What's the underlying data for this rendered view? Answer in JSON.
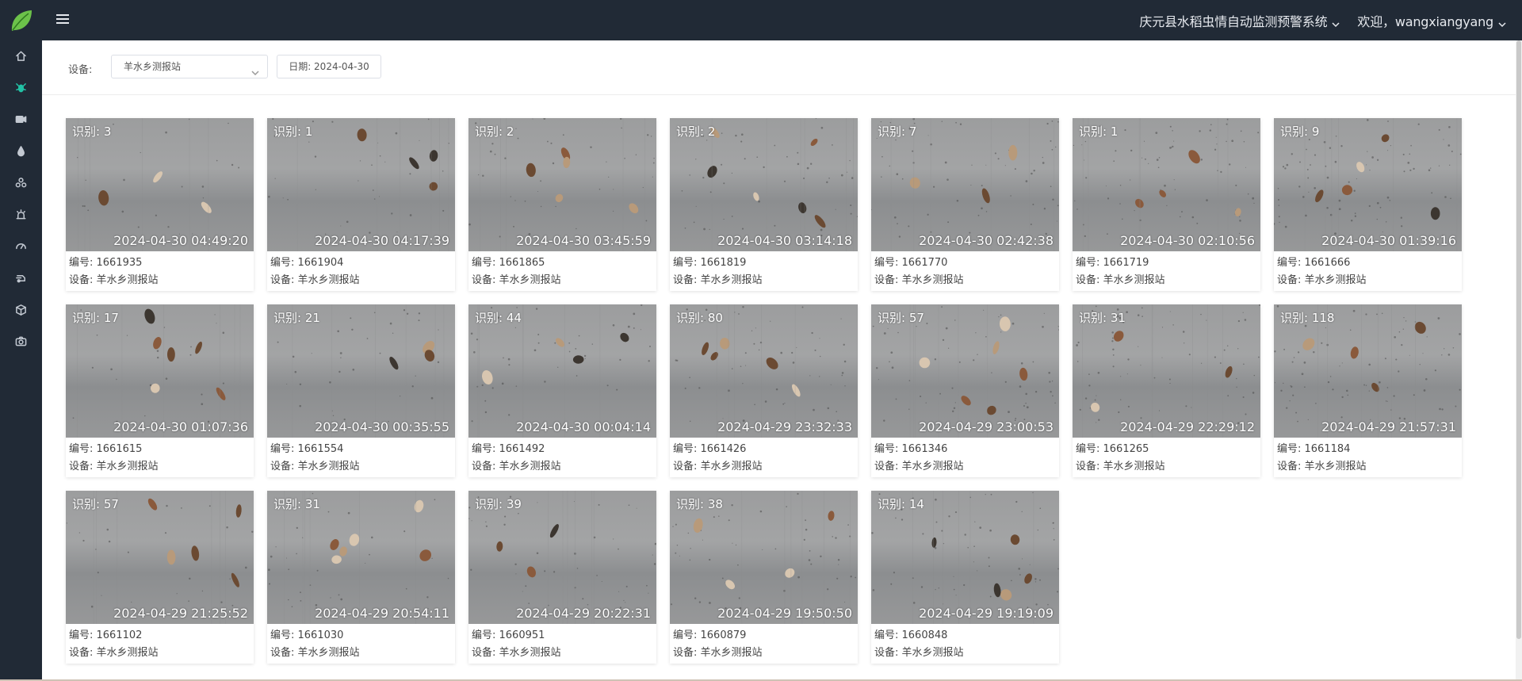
{
  "app": {
    "logo_icon": "leaf-logo-icon",
    "menu_icon": "hamburger-icon",
    "system_name": "庆元县水稻虫情自动监测预警系统",
    "welcome": "欢迎，wangxiangyang",
    "accent_color": "#22c1a5",
    "nav_background": "#212a36"
  },
  "sidebar": {
    "items": [
      {
        "icon": "home-icon",
        "active": false
      },
      {
        "icon": "bug-icon",
        "active": true
      },
      {
        "icon": "video-camera-icon",
        "active": false
      },
      {
        "icon": "water-drop-icon",
        "active": false
      },
      {
        "icon": "cluster-icon",
        "active": false
      },
      {
        "icon": "alarm-light-icon",
        "active": false
      },
      {
        "icon": "speedometer-icon",
        "active": false
      },
      {
        "icon": "trap-device-icon",
        "active": false
      },
      {
        "icon": "box-icon",
        "active": false
      },
      {
        "icon": "camera-icon",
        "active": false
      }
    ]
  },
  "filters": {
    "device_label": "设备:",
    "device_value": "羊水乡测报站",
    "date_value": "日期: 2024-04-30"
  },
  "records": [
    {
      "count": "识别: 3",
      "time": "2024-04-30 04:49:20",
      "id": "编号: 1661935",
      "device": "设备: 羊水乡测报站"
    },
    {
      "count": "识别: 1",
      "time": "2024-04-30 04:17:39",
      "id": "编号: 1661904",
      "device": "设备: 羊水乡测报站"
    },
    {
      "count": "识别: 2",
      "time": "2024-04-30 03:45:59",
      "id": "编号: 1661865",
      "device": "设备: 羊水乡测报站"
    },
    {
      "count": "识别: 2",
      "time": "2024-04-30 03:14:18",
      "id": "编号: 1661819",
      "device": "设备: 羊水乡测报站"
    },
    {
      "count": "识别: 7",
      "time": "2024-04-30 02:42:38",
      "id": "编号: 1661770",
      "device": "设备: 羊水乡测报站"
    },
    {
      "count": "识别: 1",
      "time": "2024-04-30 02:10:56",
      "id": "编号: 1661719",
      "device": "设备: 羊水乡测报站"
    },
    {
      "count": "识别: 9",
      "time": "2024-04-30 01:39:16",
      "id": "编号: 1661666",
      "device": "设备: 羊水乡测报站"
    },
    {
      "count": "识别: 17",
      "time": "2024-04-30 01:07:36",
      "id": "编号: 1661615",
      "device": "设备: 羊水乡测报站"
    },
    {
      "count": "识别: 21",
      "time": "2024-04-30 00:35:55",
      "id": "编号: 1661554",
      "device": "设备: 羊水乡测报站"
    },
    {
      "count": "识别: 44",
      "time": "2024-04-30 00:04:14",
      "id": "编号: 1661492",
      "device": "设备: 羊水乡测报站"
    },
    {
      "count": "识别: 80",
      "time": "2024-04-29 23:32:33",
      "id": "编号: 1661426",
      "device": "设备: 羊水乡测报站"
    },
    {
      "count": "识别: 57",
      "time": "2024-04-29 23:00:53",
      "id": "编号: 1661346",
      "device": "设备: 羊水乡测报站"
    },
    {
      "count": "识别: 31",
      "time": "2024-04-29 22:29:12",
      "id": "编号: 1661265",
      "device": "设备: 羊水乡测报站"
    },
    {
      "count": "识别: 118",
      "time": "2024-04-29 21:57:31",
      "id": "编号: 1661184",
      "device": "设备: 羊水乡测报站"
    },
    {
      "count": "识别: 57",
      "time": "2024-04-29 21:25:52",
      "id": "编号: 1661102",
      "device": "设备: 羊水乡测报站"
    },
    {
      "count": "识别: 31",
      "time": "2024-04-29 20:54:11",
      "id": "编号: 1661030",
      "device": "设备: 羊水乡测报站"
    },
    {
      "count": "识别: 39",
      "time": "2024-04-29 20:22:31",
      "id": "编号: 1660951",
      "device": "设备: 羊水乡测报站"
    },
    {
      "count": "识别: 38",
      "time": "2024-04-29 19:50:50",
      "id": "编号: 1660879",
      "device": "设备: 羊水乡测报站"
    },
    {
      "count": "识别: 14",
      "time": "2024-04-29 19:19:09",
      "id": "编号: 1660848",
      "device": "设备: 羊水乡测报站"
    }
  ]
}
